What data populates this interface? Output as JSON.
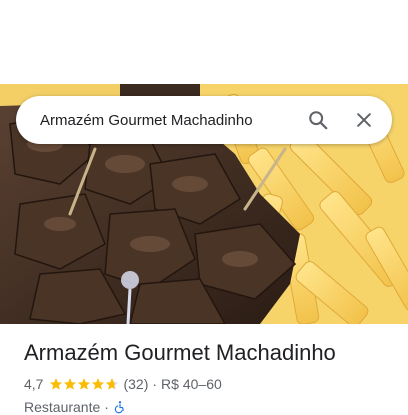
{
  "search": {
    "query": "Armazém Gourmet Machadinho"
  },
  "place": {
    "name": "Armazém Gourmet Machadinho",
    "rating": "4,7",
    "rating_value": 4.7,
    "review_count": "(32)",
    "separator": "·",
    "price_range": "R$ 40–60",
    "category": "Restaurante",
    "category_separator": "·"
  },
  "icons": {
    "search": "search-icon",
    "close": "close-icon",
    "star": "star-icon",
    "accessibility": "wheelchair-icon"
  },
  "colors": {
    "star": "#fbbc04",
    "accessibility": "#1a73e8",
    "text_primary": "#202124",
    "text_secondary": "#5f6368"
  }
}
